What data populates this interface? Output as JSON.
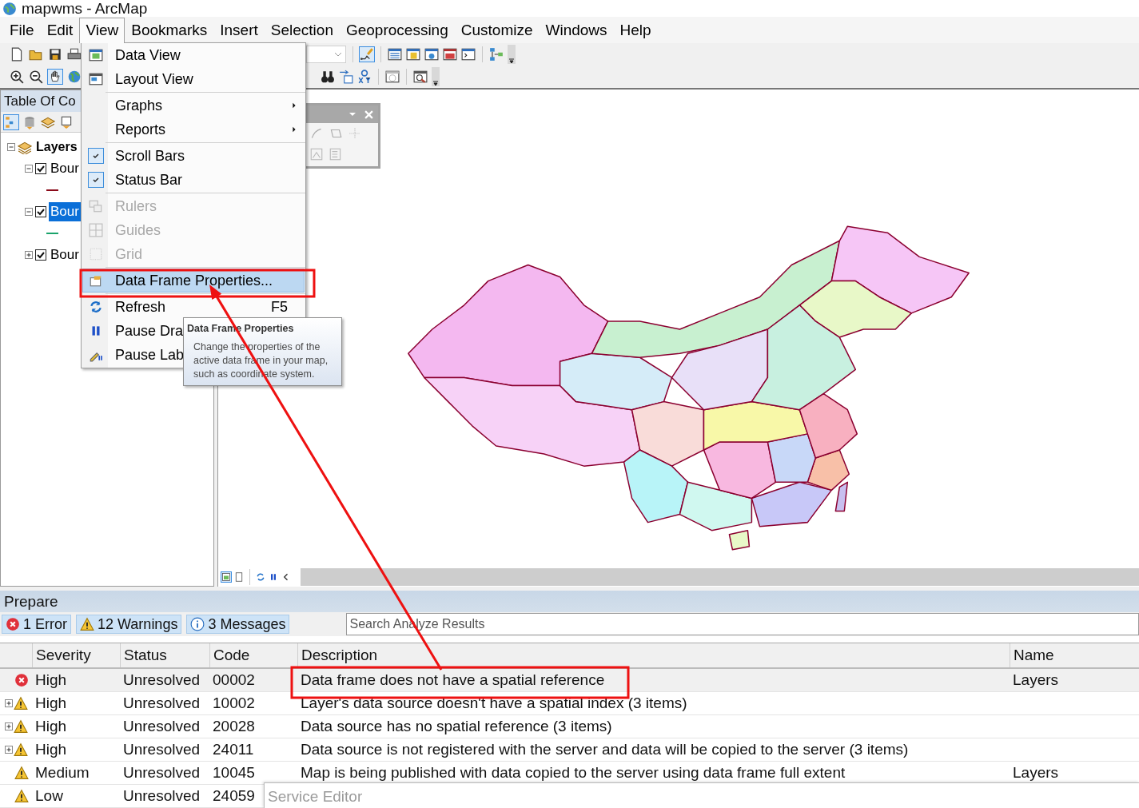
{
  "window": {
    "title": "mapwms - ArcMap"
  },
  "menu_bar": [
    {
      "label": "File",
      "selected": false
    },
    {
      "label": "Edit",
      "selected": false
    },
    {
      "label": "View",
      "selected": true
    },
    {
      "label": "Bookmarks",
      "selected": false
    },
    {
      "label": "Insert",
      "selected": false
    },
    {
      "label": "Selection",
      "selected": false
    },
    {
      "label": "Geoprocessing",
      "selected": false
    },
    {
      "label": "Customize",
      "selected": false
    },
    {
      "label": "Windows",
      "selected": false
    },
    {
      "label": "Help",
      "selected": false
    }
  ],
  "view_menu": [
    {
      "kind": "item",
      "label": "Data View",
      "checked": false,
      "disabled": false,
      "selected": false,
      "submenu": false
    },
    {
      "kind": "item",
      "label": "Layout View",
      "checked": false,
      "disabled": false,
      "selected": false,
      "submenu": false
    },
    {
      "kind": "separator"
    },
    {
      "kind": "item",
      "label": "Graphs",
      "checked": false,
      "disabled": false,
      "selected": false,
      "submenu": true
    },
    {
      "kind": "item",
      "label": "Reports",
      "checked": false,
      "disabled": false,
      "selected": false,
      "submenu": true
    },
    {
      "kind": "separator"
    },
    {
      "kind": "item",
      "label": "Scroll Bars",
      "checked": true,
      "disabled": false,
      "selected": false,
      "submenu": false
    },
    {
      "kind": "item",
      "label": "Status Bar",
      "checked": true,
      "disabled": false,
      "selected": false,
      "submenu": false
    },
    {
      "kind": "separator"
    },
    {
      "kind": "item",
      "label": "Rulers",
      "checked": false,
      "disabled": true,
      "selected": false,
      "submenu": false
    },
    {
      "kind": "item",
      "label": "Guides",
      "checked": false,
      "disabled": true,
      "selected": false,
      "submenu": false
    },
    {
      "kind": "item",
      "label": "Grid",
      "checked": false,
      "disabled": true,
      "selected": false,
      "submenu": false
    },
    {
      "kind": "separator"
    },
    {
      "kind": "item",
      "label": "Data Frame Properties...",
      "checked": false,
      "disabled": false,
      "selected": true,
      "submenu": false
    },
    {
      "kind": "separator"
    },
    {
      "kind": "item",
      "label": "Refresh",
      "shortcut": "F5",
      "checked": false,
      "disabled": false,
      "selected": false,
      "submenu": false
    },
    {
      "kind": "item",
      "label": "Pause Dra",
      "checked": false,
      "disabled": false,
      "selected": false,
      "submenu": false
    },
    {
      "kind": "item",
      "label": "Pause Lab",
      "checked": false,
      "disabled": false,
      "selected": false,
      "submenu": false
    }
  ],
  "tooltip": {
    "title": "Data Frame Properties",
    "text": "Change the properties of the active data frame in your map, such as coordinate system."
  },
  "toc": {
    "title": "Table Of Co",
    "tree": [
      {
        "label": "Layers",
        "expanded": true,
        "children": [
          {
            "label": "Bour",
            "checked": true,
            "expanded": true,
            "selected": false,
            "color": "#8b0a1a"
          },
          {
            "label": "Bour",
            "checked": true,
            "expanded": true,
            "selected": true,
            "color": "#1aa36b"
          },
          {
            "label": "Bour",
            "checked": true,
            "expanded": false,
            "selected": false
          }
        ]
      }
    ]
  },
  "prepare": {
    "title": "Prepare",
    "filters": [
      {
        "kind": "error",
        "label": "1 Error",
        "on": true
      },
      {
        "kind": "warning",
        "label": "12 Warnings",
        "on": true
      },
      {
        "kind": "info",
        "label": "3 Messages",
        "on": true
      }
    ],
    "search": {
      "placeholder": "Search Analyze Results"
    },
    "columns": [
      "Severity",
      "Status",
      "Code",
      "Description",
      "Name"
    ],
    "rows": [
      {
        "kind": "error",
        "expandable": false,
        "selected": true,
        "severity": "High",
        "status": "Unresolved",
        "code": "00002",
        "description": "Data frame does not have a spatial reference",
        "name": "Layers"
      },
      {
        "kind": "warning",
        "expandable": true,
        "selected": false,
        "severity": "High",
        "status": "Unresolved",
        "code": "10002",
        "description": "Layer's data source doesn't have a spatial index (3 items)"
      },
      {
        "kind": "warning",
        "expandable": true,
        "selected": false,
        "severity": "High",
        "status": "Unresolved",
        "code": "20028",
        "description": "Data source has no spatial reference (3 items)"
      },
      {
        "kind": "warning",
        "expandable": true,
        "selected": false,
        "severity": "High",
        "status": "Unresolved",
        "code": "24011",
        "description": "Data source is not registered with the server and data will be copied to the server (3 items)"
      },
      {
        "kind": "warning",
        "expandable": false,
        "selected": false,
        "severity": "Medium",
        "status": "Unresolved",
        "code": "10045",
        "description": "Map is being published with data copied to the server using data frame full extent",
        "name": "Layers"
      },
      {
        "kind": "warning",
        "expandable": false,
        "selected": false,
        "severity": "Low",
        "status": "Unresolved",
        "code": "24059"
      }
    ]
  },
  "service_editor": {
    "title": "Service Editor"
  }
}
